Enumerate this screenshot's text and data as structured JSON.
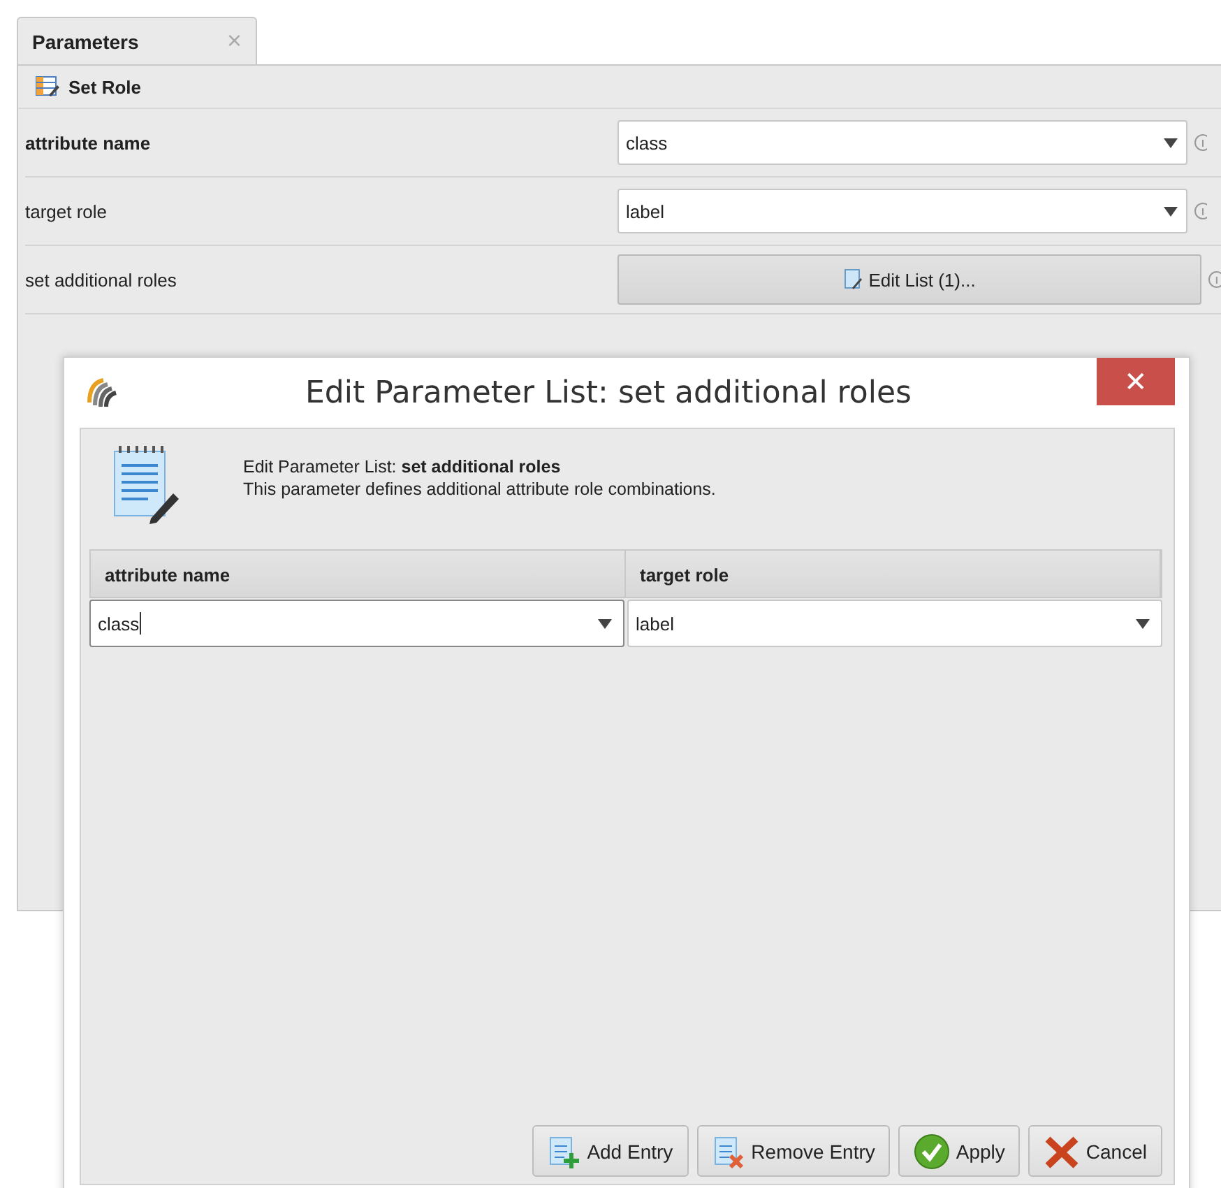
{
  "tabs": [
    {
      "label": "Parameters",
      "close": "×",
      "selected": true
    }
  ],
  "operator": {
    "title": "Set Role"
  },
  "parameters": [
    {
      "label": "attribute name",
      "kind": "combo",
      "value": "class",
      "bold": true
    },
    {
      "label": "target role",
      "kind": "combo",
      "value": "label",
      "bold": false
    },
    {
      "label": "set additional roles",
      "kind": "button",
      "value": "Edit List (1)...",
      "bold": false
    }
  ],
  "dialog": {
    "title": "Edit Parameter List: set additional roles",
    "close": "✕",
    "heading": "Edit Parameter List: **set additional roles**",
    "description": "This parameter defines additional attribute role combinations.",
    "table": {
      "columns": [
        "attribute name",
        "target role"
      ],
      "rows": [
        [
          {
            "value": "class",
            "focused": true
          },
          {
            "value": "label",
            "focused": false
          }
        ]
      ]
    },
    "buttons": [
      {
        "label": "Add Entry",
        "kind": "add"
      },
      {
        "label": "Remove Entry",
        "kind": "remove"
      },
      {
        "label": "Apply",
        "kind": "apply"
      },
      {
        "label": "Cancel",
        "kind": "cancel"
      }
    ]
  }
}
